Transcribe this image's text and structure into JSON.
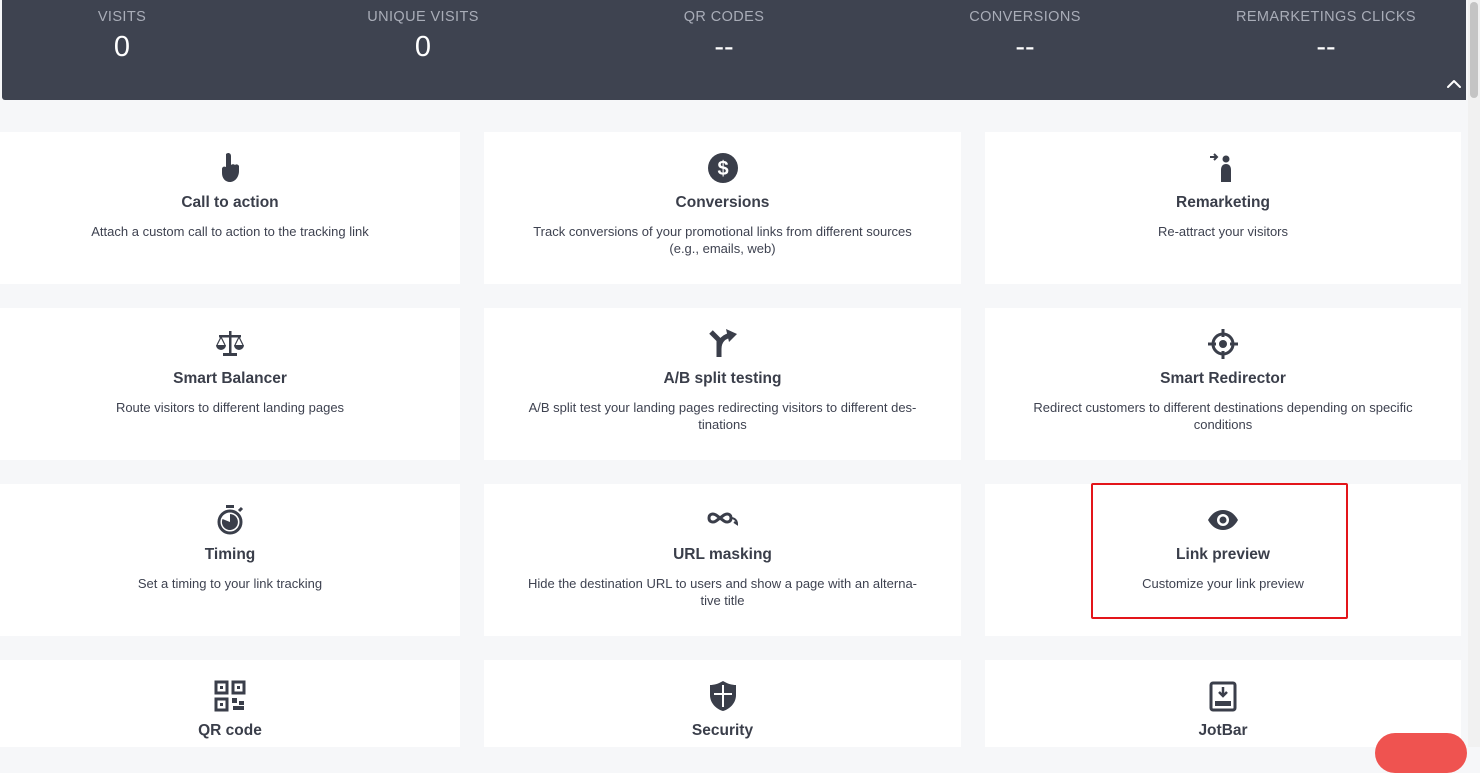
{
  "stats": [
    {
      "label": "VISITS",
      "value": "0"
    },
    {
      "label": "UNIQUE VISITS",
      "value": "0"
    },
    {
      "label": "QR CODES",
      "value": "--"
    },
    {
      "label": "CONVERSIONS",
      "value": "--"
    },
    {
      "label": "REMARKETINGS CLICKS",
      "value": "--"
    }
  ],
  "collapse_icon": "chevron-up-icon",
  "features": [
    {
      "title": "Call to action",
      "description": "Attach a custom call to action to the tracking link",
      "icon": "hand-pointer-icon"
    },
    {
      "title": "Conversions",
      "description": "Track conversions of your promotional links from different sources (e.g., emails, web)",
      "icon": "dollar-coin-icon"
    },
    {
      "title": "Remarketing",
      "description": "Re-attract your visitors",
      "icon": "user-return-icon"
    },
    {
      "title": "Smart Balancer",
      "description": "Route visitors to different landing pages",
      "icon": "balance-scale-icon"
    },
    {
      "title": "A/B split testing",
      "description": "A/B split test your landing pages redirecting visitors to different des-tinations",
      "icon": "split-arrow-icon"
    },
    {
      "title": "Smart Redirector",
      "description": "Redirect customers to different destinations depending on specific conditions",
      "icon": "crosshair-icon"
    },
    {
      "title": "Timing",
      "description": "Set a timing to your link tracking",
      "icon": "stopwatch-icon"
    },
    {
      "title": "URL masking",
      "description": "Hide the destination URL to users and show a page with an alterna-tive title",
      "icon": "mask-icon"
    },
    {
      "title": "Link preview",
      "description": "Customize your link preview",
      "icon": "eye-icon"
    },
    {
      "title": "QR code",
      "description": "",
      "icon": "qr-code-icon"
    },
    {
      "title": "Security",
      "description": "",
      "icon": "shield-icon"
    },
    {
      "title": "JotBar",
      "description": "",
      "icon": "jotbar-icon"
    }
  ],
  "highlighted_feature": "Link preview",
  "colors": {
    "stats_bar_bg": "#3e4350",
    "highlight_border": "#e3151a",
    "chat_bubble": "#ef5350"
  }
}
